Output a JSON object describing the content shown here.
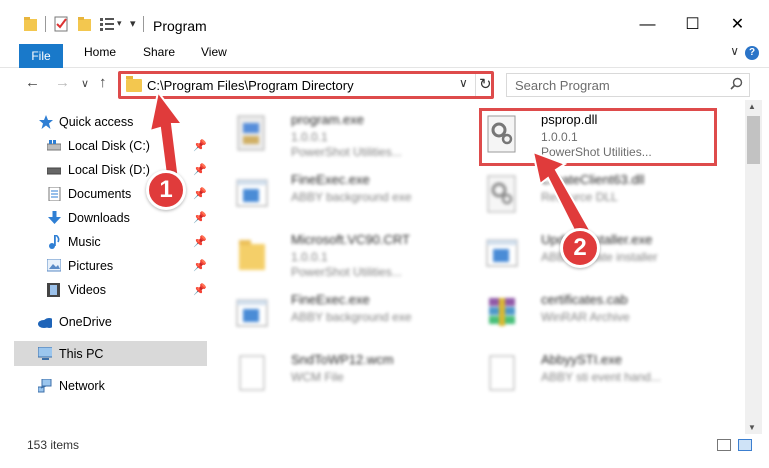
{
  "window": {
    "title": "Program",
    "minimize_glyph": "—",
    "maximize_glyph": "☐",
    "close_glyph": "✕"
  },
  "ribbon": {
    "tabs": [
      "File",
      "Home",
      "Share",
      "View"
    ],
    "expand_glyph": "∨",
    "help_glyph": "?"
  },
  "address_bar": {
    "path": "C:\\Program Files\\Program Directory",
    "dropdown_glyph": "∨",
    "refresh_glyph": "↻"
  },
  "nav_buttons": {
    "back": "←",
    "forward": "→",
    "recent": "∨",
    "up": "↑"
  },
  "search": {
    "placeholder": "Search Program",
    "icon": "search-icon"
  },
  "sidebar": {
    "items": [
      {
        "label": "Quick access",
        "icon": "star-icon",
        "pinned": false
      },
      {
        "label": "Local Disk (C:)",
        "icon": "drive-icon",
        "pinned": true
      },
      {
        "label": "Local Disk (D:)",
        "icon": "drive-icon",
        "pinned": true
      },
      {
        "label": "Documents",
        "icon": "documents-icon",
        "pinned": true
      },
      {
        "label": "Downloads",
        "icon": "download-icon",
        "pinned": true
      },
      {
        "label": "Music",
        "icon": "music-icon",
        "pinned": true
      },
      {
        "label": "Pictures",
        "icon": "pictures-icon",
        "pinned": true
      },
      {
        "label": "Videos",
        "icon": "video-icon",
        "pinned": true
      },
      {
        "label": "OneDrive",
        "icon": "cloud-icon",
        "pinned": false
      },
      {
        "label": "This PC",
        "icon": "computer-icon",
        "pinned": false,
        "selected": true
      },
      {
        "label": "Network",
        "icon": "network-icon",
        "pinned": false
      }
    ],
    "pin_glyph": "📌"
  },
  "files": [
    {
      "name": "program.exe",
      "line2": "1.0.0.1",
      "line3": "PowerShot Utilities...",
      "kind": "exe-app",
      "blurred": true
    },
    {
      "name": "psprop.dll",
      "line2": "1.0.0.1",
      "line3": "PowerShot Utilities...",
      "kind": "dll",
      "blurred": false
    },
    {
      "name": "FineExec.exe",
      "line2": "ABBY background exe",
      "line3": "",
      "kind": "exe-window",
      "blurred": true
    },
    {
      "name": "CreateClient63.dll",
      "line2": "Resource DLL",
      "line3": "",
      "kind": "dll",
      "blurred": true
    },
    {
      "name": "Microsoft.VC90.CRT",
      "line2": "1.0.0.1",
      "line3": "PowerShot Utilities...",
      "kind": "folder",
      "blurred": true
    },
    {
      "name": "UpdateInstaller.exe",
      "line2": "ABBY update installer",
      "line3": "",
      "kind": "exe-window",
      "blurred": true
    },
    {
      "name": "FineExec.exe",
      "line2": "ABBY background exe",
      "line3": "",
      "kind": "exe-window",
      "blurred": true
    },
    {
      "name": "certificates.cab",
      "line2": "WinRAR Archive",
      "line3": "",
      "kind": "archive",
      "blurred": true
    },
    {
      "name": "SndToWP12.wcm",
      "line2": "WCM File",
      "line3": "",
      "kind": "blank",
      "blurred": true
    },
    {
      "name": "AbbyySTI.exe",
      "line2": "ABBY sti event hand...",
      "line3": "",
      "kind": "blank",
      "blurred": true
    }
  ],
  "status": {
    "item_count": "153 items"
  },
  "annotations": {
    "badge_1": "1",
    "badge_2": "2",
    "color": "#e03b3b"
  },
  "colors": {
    "accent": "#1979ca",
    "highlight": "#de4b4b",
    "selection": "#d9d9d9"
  }
}
